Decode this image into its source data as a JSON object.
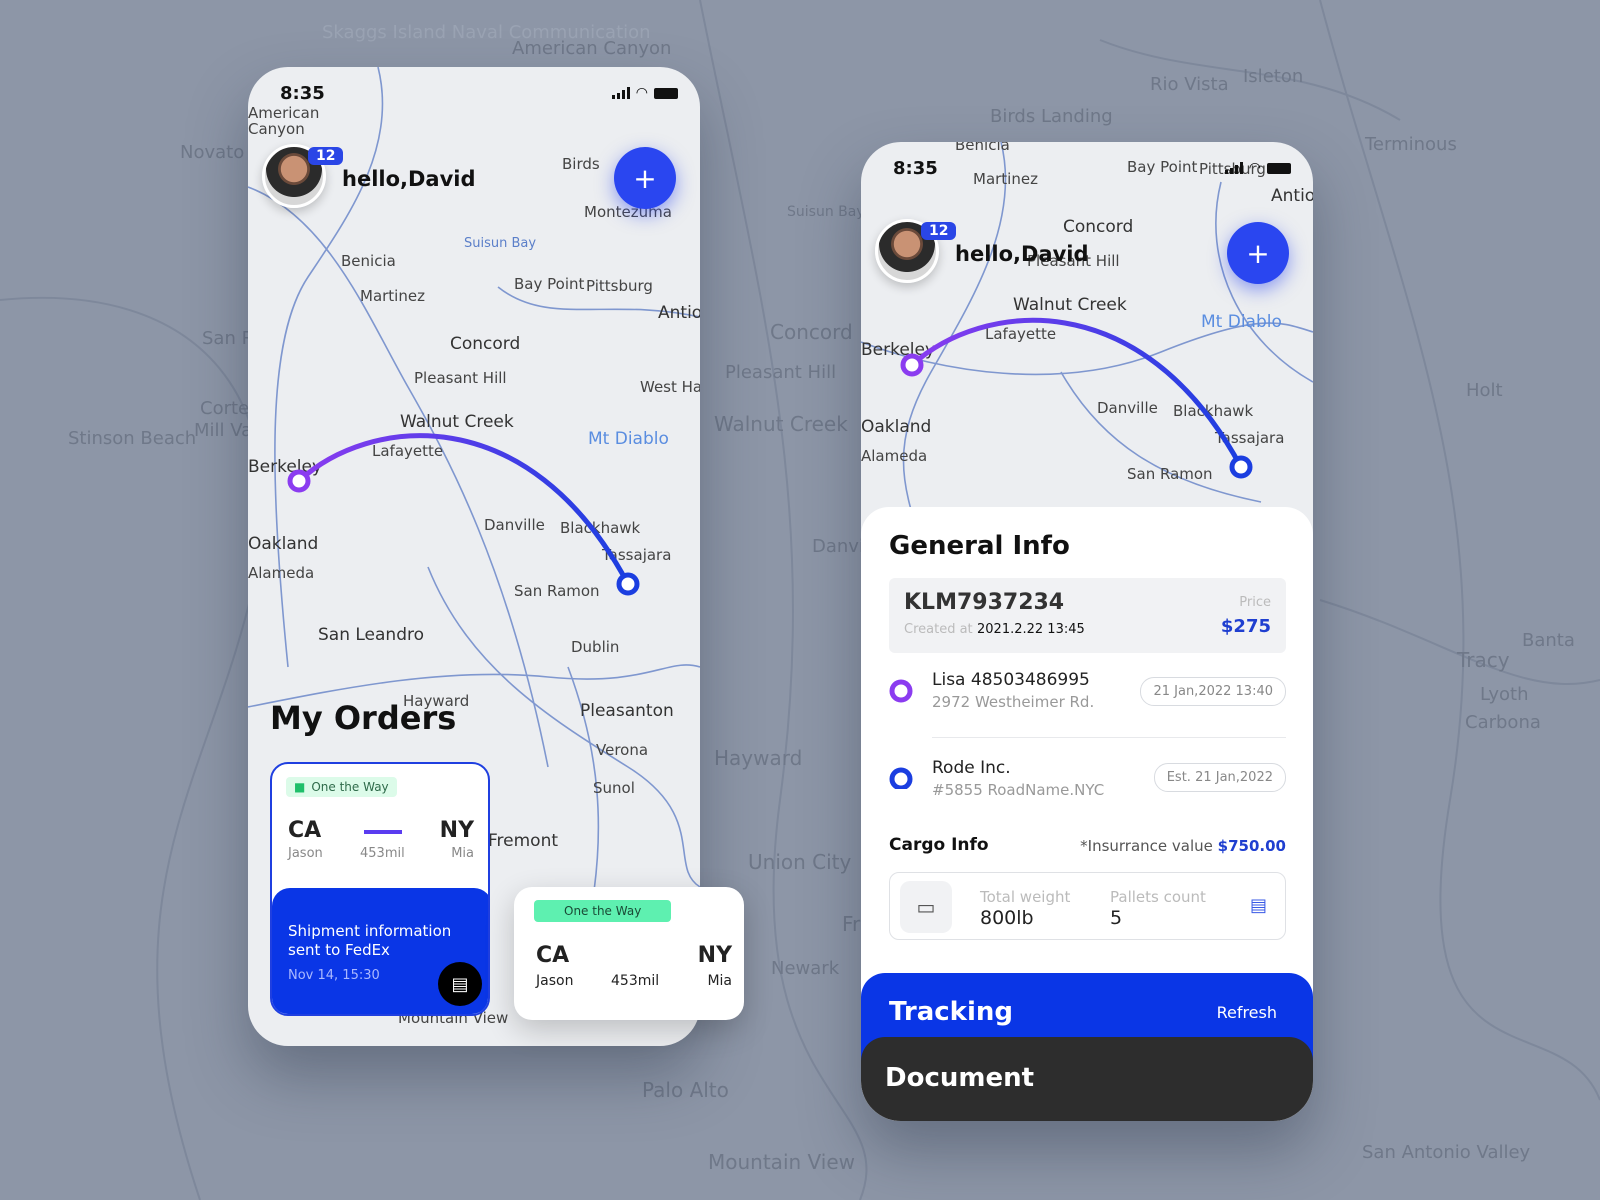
{
  "background_map": {
    "labels": [
      "Novato",
      "Stinson Beach",
      "San Rafael",
      "Corte Madera",
      "Mill Valley",
      "Skaggs Island Naval Communication",
      "American Canyon",
      "Rio Vista",
      "Isleton",
      "Birds Landing",
      "Terminous",
      "Suisun Bay",
      "Concord",
      "Pleasant Hill",
      "Walnut Creek",
      "Danville",
      "Holt",
      "Tracy",
      "Lyoth",
      "Carbona",
      "Banta",
      "Hayward",
      "Union City",
      "Fremont",
      "Newark",
      "Palo Alto",
      "Mountain View",
      "San Antonio Valley"
    ]
  },
  "colors": {
    "accent": "#2a46f0",
    "route_start": "#8b3cf0",
    "route_end": "#1b3ee0",
    "tag_green": "#5ef0b0",
    "dark": "#2d2d2d"
  },
  "left_phone": {
    "status": {
      "time": "8:35"
    },
    "map_labels": [
      "American Canyon",
      "Benicia",
      "Martinez",
      "Suisun Bay",
      "Bay Point",
      "Pittsburg",
      "Antioch",
      "Concord",
      "Pleasant Hill",
      "West Harbor",
      "Walnut Creek",
      "Lafayette",
      "Mt Diablo",
      "Berkeley",
      "Oakland",
      "Alameda",
      "Danville",
      "Blackhawk",
      "Tassajara",
      "San Ramon",
      "San Leandro",
      "Dublin",
      "Hayward",
      "Pleasanton",
      "Verona",
      "Sunol",
      "Fremont",
      "Mountain View",
      "Birds",
      "Montezuma"
    ],
    "user": {
      "greeting": "hello,David",
      "notifications": "12"
    },
    "add_icon": "plus-icon",
    "title": "My Orders",
    "orders": [
      {
        "status": "One the Way",
        "from": "CA",
        "from_name": "Jason",
        "distance": "453mil",
        "to": "NY",
        "to_name": "Mia",
        "update": "Shipment information sent to FedEx",
        "update_time": "Nov 14, 15:30"
      },
      {
        "status": "One the Way",
        "from": "CA",
        "from_name": "Jason",
        "distance": "453mil",
        "to": "NY",
        "to_name": "Mia"
      }
    ]
  },
  "right_phone": {
    "status": {
      "time": "8:35"
    },
    "map_labels": [
      "Benicia",
      "Martinez",
      "Bay Point",
      "Pittsburg",
      "Antioch",
      "Concord",
      "Pleasant Hill",
      "Walnut Creek",
      "Lafayette",
      "Mt Diablo",
      "Berkeley",
      "Oakland",
      "Alameda",
      "Danville",
      "Blackhawk",
      "Tassajara",
      "San Ramon"
    ],
    "user": {
      "greeting": "hello,David",
      "notifications": "12"
    },
    "general": {
      "title": "General Info",
      "order_id": "KLM7937234",
      "created_label": "Created at",
      "created_value": "2021.2.22 13:45",
      "price_label": "Price",
      "price_value": "$275",
      "pickup": {
        "name": "Lisa 48503486995",
        "address": "2972 Westheimer Rd.",
        "time": "21 Jan,2022 13:40"
      },
      "dropoff": {
        "name": "Rode Inc.",
        "address": "#5855 RoadName.NYC",
        "time": "Est.  21 Jan,2022"
      }
    },
    "cargo": {
      "title": "Cargo Info",
      "insurance_label": "*Insurrance value",
      "insurance_value": "$750.00",
      "weight_label": "Total weight",
      "weight_value": "800lb",
      "pallets_label": "Pallets count",
      "pallets_value": "5"
    },
    "tracking": {
      "label": "Tracking",
      "refresh": "Refresh"
    },
    "document": {
      "label": "Document"
    }
  }
}
